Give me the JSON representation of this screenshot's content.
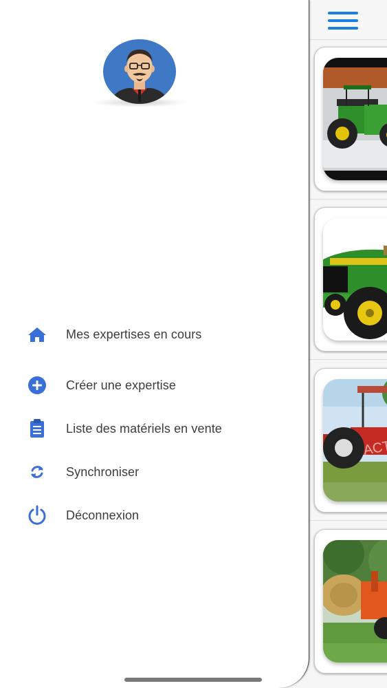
{
  "header": {
    "menu_icon": "hamburger-icon",
    "accent_color": "#1a7fe0"
  },
  "drawer": {
    "avatar_icon": "user-avatar-icon",
    "menu": [
      {
        "icon": "home-icon",
        "label": "Mes expertises en cours"
      },
      {
        "icon": "add-circle-icon",
        "label": "Créer une expertise"
      },
      {
        "icon": "clipboard-icon",
        "label": "Liste des matériels en vente"
      },
      {
        "icon": "sync-icon",
        "label": "Synchroniser"
      },
      {
        "icon": "power-icon",
        "label": "Déconnexion"
      }
    ],
    "icon_color": "#3a6fd8",
    "label_color": "#3c3c3c"
  },
  "listing": {
    "cards": [
      {
        "image": "green-tractor-snow"
      },
      {
        "image": "green-tractor-closeup"
      },
      {
        "image": "red-tractor-field"
      },
      {
        "image": "orange-bale-loader"
      }
    ]
  }
}
